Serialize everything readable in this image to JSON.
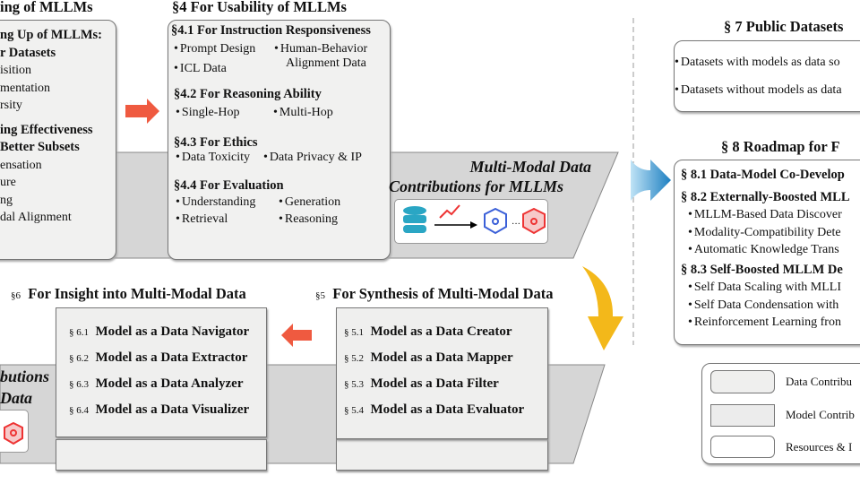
{
  "s3": {
    "title": "ing of MLLMs",
    "h1": "ng Up of MLLMs:",
    "h2": "r Datasets",
    "items1": [
      "isition",
      "mentation",
      "rsity"
    ],
    "h3": "ing Effectiveness",
    "h4": "Better Subsets",
    "items2": [
      "ensation",
      "ure",
      "ng",
      "dal Alignment"
    ]
  },
  "s4": {
    "title": "§4  For Usability of MLLMs",
    "s41": {
      "title": "§4.1 For Instruction Responsiveness",
      "items": [
        "Prompt Design",
        "ICL Data",
        "Human-Behavior",
        "Alignment Data"
      ]
    },
    "s42": {
      "title": "§4.2  For Reasoning Ability",
      "items": [
        "Single-Hop",
        "Multi-Hop"
      ]
    },
    "s43": {
      "title": "§4.3  For Ethics",
      "items": [
        "Data Toxicity",
        "Data Privacy & IP"
      ]
    },
    "s44": {
      "title": "§4.4  For Evaluation",
      "items": [
        "Understanding",
        "Generation",
        "Retrieval",
        "Reasoning"
      ]
    }
  },
  "band_top": {
    "line1": "Multi-Modal Data",
    "line2": "Contributions for MLLMs"
  },
  "band_bottom": {
    "line1": "butions",
    "line2": "Data"
  },
  "s6": {
    "title": "For Insight into Multi-Modal Data",
    "num": "§6",
    "rows": [
      {
        "num": "§ 6.1",
        "label": "Model as a Data Navigator"
      },
      {
        "num": "§ 6.2",
        "label": "Model as a Data Extractor"
      },
      {
        "num": "§ 6.3",
        "label": "Model as a Data Analyzer"
      },
      {
        "num": "§ 6.4",
        "label": "Model as a Data Visualizer"
      }
    ]
  },
  "s5": {
    "title": "For Synthesis of Multi-Modal Data",
    "num": "§5",
    "rows": [
      {
        "num": "§ 5.1",
        "label": "Model as a Data Creator"
      },
      {
        "num": "§ 5.2",
        "label": "Model as a Data Mapper"
      },
      {
        "num": "§ 5.3",
        "label": "Model as a Data Filter"
      },
      {
        "num": "§ 5.4",
        "label": "Model as a Data Evaluator"
      }
    ]
  },
  "s7": {
    "title": "§ 7 Public Datasets",
    "items": [
      "Datasets with models as data so",
      "Datasets without models as data"
    ]
  },
  "s8": {
    "title": "§ 8  Roadmap for F",
    "h1": "§ 8.1  Data-Model Co-Develop",
    "h2": "§ 8.2  Externally-Boosted MLL",
    "items2": [
      "MLLM-Based Data Discover",
      "Modality-Compatibility Dete",
      "Automatic Knowledge Trans"
    ],
    "h3": "§ 8.3  Self-Boosted MLLM De",
    "items3": [
      "Self Data Scaling with MLLI",
      "Self Data Condensation with",
      "Reinforcement Learning fron"
    ]
  },
  "legend": {
    "items": [
      "Data Contribu",
      "Model Contrib",
      "Resources & I"
    ]
  },
  "colors": {
    "red_arrow": "#ef5a40",
    "blue_arrow": "#2b8fd0",
    "yellow_arrow": "#f3b81a",
    "band": "#d6d6d6"
  }
}
